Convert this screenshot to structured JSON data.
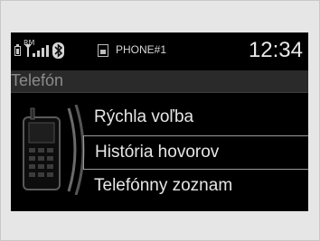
{
  "status": {
    "signal_tag": "RM",
    "device_label": "PHONE#1",
    "clock": "12:34"
  },
  "header": {
    "title": "Telefón"
  },
  "menu": {
    "items": [
      {
        "label": "Rýchla voľba",
        "selected": false
      },
      {
        "label": "História hovorov",
        "selected": true
      },
      {
        "label": "Telefónny zoznam",
        "selected": false
      }
    ]
  },
  "icons": {
    "battery": "battery-icon",
    "signal": "signal-strength-icon",
    "bluetooth": "bluetooth-icon",
    "device": "phone-device-icon",
    "handset": "mobile-phone-icon"
  },
  "colors": {
    "screen_background": "#000000",
    "text": "#e6e6e6",
    "title_text": "#8c8c8c",
    "selection_border": "#9a9a9a"
  }
}
